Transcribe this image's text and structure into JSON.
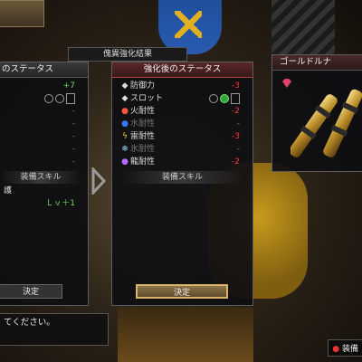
{
  "window_title": "傀異強化結果",
  "left_panel": {
    "title": "のステータス",
    "plus_value": "+7",
    "dash": "-",
    "skill_header": "装備スキル",
    "skill_name": "護",
    "skill_level": "Ｌｖ＋1",
    "confirm": "決定"
  },
  "right_panel": {
    "title": "強化後のステータス",
    "stats": [
      {
        "label": "防御力",
        "value": "-3",
        "color": "#ff3a3a",
        "icon": "diamond-icon"
      },
      {
        "label": "スロット",
        "value": "",
        "icon": "diamond-icon"
      },
      {
        "label": "火耐性",
        "value": "-2",
        "color": "#ff3a3a",
        "icon": "fire-icon"
      },
      {
        "label": "水耐性",
        "value": "-",
        "icon": "water-icon"
      },
      {
        "label": "雷耐性",
        "value": "-3",
        "color": "#ff3a3a",
        "icon": "thunder-icon"
      },
      {
        "label": "氷耐性",
        "value": "-",
        "icon": "ice-icon"
      },
      {
        "label": "龍耐性",
        "value": "-2",
        "color": "#ff3a3a",
        "icon": "dragon-icon"
      }
    ],
    "skill_header": "装備スキル",
    "confirm": "決定"
  },
  "weapon_panel": {
    "title": "ゴールドルナ"
  },
  "message": "てください。",
  "hint": "装備"
}
